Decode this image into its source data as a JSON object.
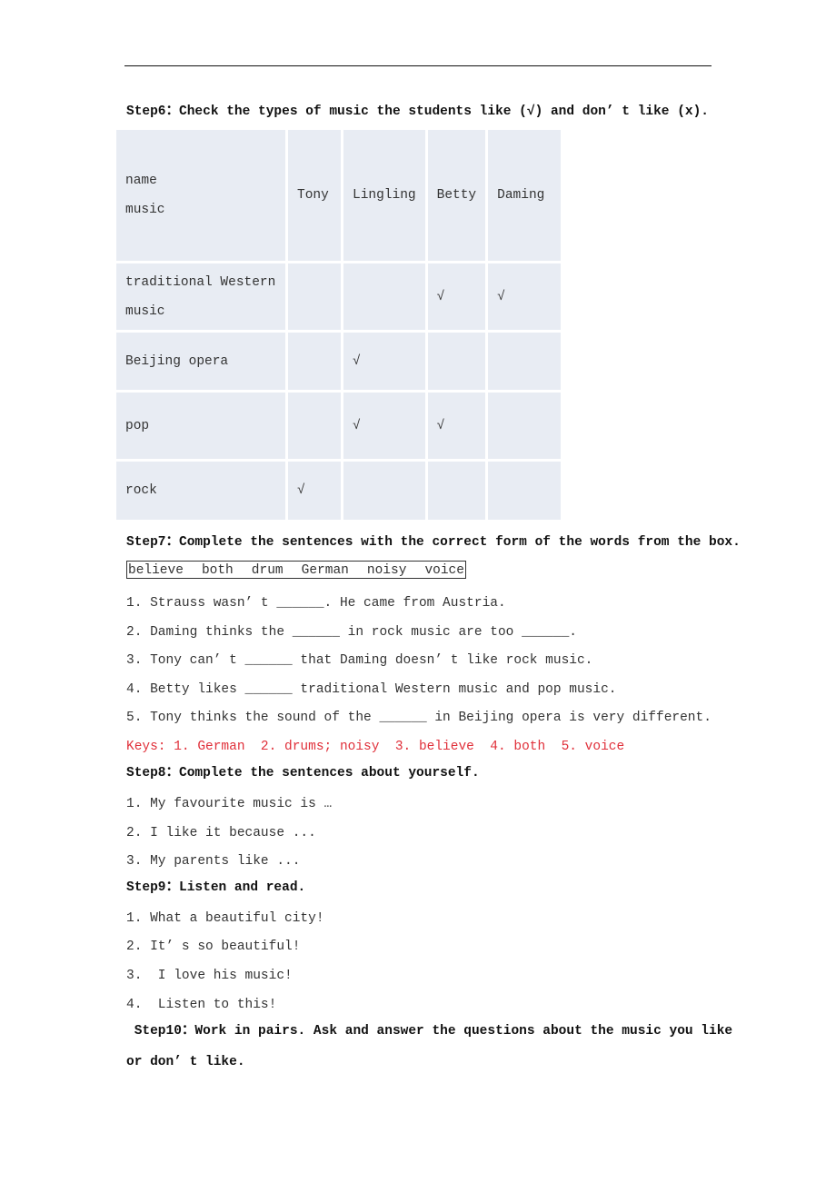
{
  "step6": {
    "title": "Step6：Check the types of music the students like (√) and don’ t like (x).",
    "table": {
      "corner_top": "name",
      "corner_bottom": "music",
      "columns": [
        "Tony",
        "Lingling",
        "Betty",
        "Daming"
      ],
      "rows": [
        {
          "music": "traditional  Western music",
          "line1": "traditional  Western",
          "line2": "music",
          "checks": [
            "",
            "",
            "√",
            "√"
          ]
        },
        {
          "music": "Beijing opera",
          "checks": [
            "",
            "√",
            "",
            ""
          ]
        },
        {
          "music": "pop",
          "checks": [
            "",
            "√",
            "√",
            ""
          ]
        },
        {
          "music": "rock",
          "checks": [
            "√",
            "",
            "",
            ""
          ]
        }
      ]
    }
  },
  "step7": {
    "title": "Step7：Complete the sentences with the correct form of the words from the box.",
    "words": [
      "believe",
      "both",
      "drum",
      "German",
      "noisy",
      "voice"
    ],
    "sentences": [
      "1. Strauss wasn’ t ______. He came from Austria.",
      "2. Daming thinks the ______ in rock music are too ______.",
      "3. Tony can’ t ______ that Daming doesn’ t like rock music.",
      "4. Betty likes ______ traditional Western music and pop music.",
      "5. Tony thinks the sound of the ______ in Beijing opera is very different."
    ],
    "keys": "Keys: 1. German  2. drums; noisy  3. believe  4. both  5. voice"
  },
  "step8": {
    "title": "Step8：Complete the sentences about yourself.",
    "sentences": [
      "1. My favourite music is …",
      "2. I like it because ...",
      "3. My parents like ..."
    ]
  },
  "step9": {
    "title": "Step9：Listen and read.",
    "sentences": [
      "1. What a beautiful city!",
      "2. It’ s so beautiful!",
      "3.  I love his music!",
      "4.  Listen to this!"
    ]
  },
  "step10": {
    "title_line1": " Step10：Work in pairs. Ask and answer the questions about the music you like",
    "title_line2": "or don’ t like."
  },
  "colors": {
    "check": "#d9303c",
    "keys": "#e0303a",
    "table_cell": "#e8ecf3"
  }
}
